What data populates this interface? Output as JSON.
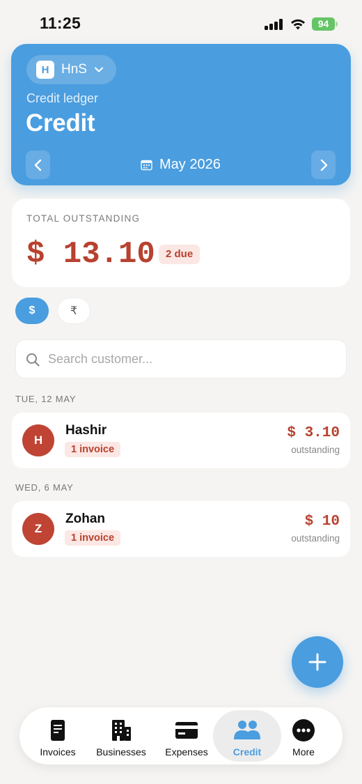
{
  "status_bar": {
    "time": "11:25",
    "battery": "94"
  },
  "header": {
    "business_initial": "H",
    "business_name": "HnS",
    "subtitle": "Credit ledger",
    "title": "Credit",
    "month": "May 2026"
  },
  "summary": {
    "label": "TOTAL OUTSTANDING",
    "amount": "$ 13.10",
    "due_badge": "2 due"
  },
  "currency_chips": {
    "usd": "$",
    "inr": "₹"
  },
  "search": {
    "placeholder": "Search customer...",
    "value": ""
  },
  "groups": [
    {
      "date": "TUE, 12 MAY",
      "customer": {
        "initial": "H",
        "name": "Hashir",
        "invoices": "1 invoice",
        "amount": "$ 3.10",
        "status": "outstanding"
      }
    },
    {
      "date": "WED, 6 MAY",
      "customer": {
        "initial": "Z",
        "name": "Zohan",
        "invoices": "1 invoice",
        "amount": "$ 10",
        "status": "outstanding"
      }
    }
  ],
  "tabs": [
    {
      "label": "Invoices",
      "icon": "document-icon"
    },
    {
      "label": "Businesses",
      "icon": "building-icon"
    },
    {
      "label": "Expenses",
      "icon": "credit-card-icon"
    },
    {
      "label": "Credit",
      "icon": "people-icon",
      "active": true
    },
    {
      "label": "More",
      "icon": "more-icon"
    }
  ],
  "colors": {
    "accent": "#4a9ddf",
    "danger": "#b8412f",
    "danger_bg": "#fbe7e3",
    "background": "#f5f4f2"
  }
}
